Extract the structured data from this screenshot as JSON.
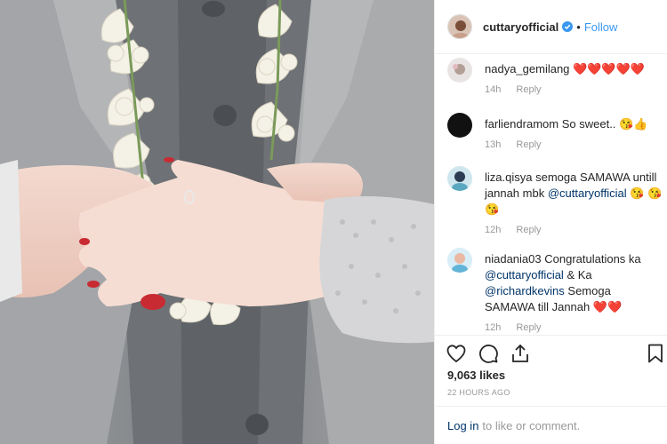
{
  "post": {
    "username": "cuttaryofficial",
    "separator": "•",
    "follow_label": "Follow"
  },
  "comments": [
    {
      "username": "nadya_gemilang",
      "text_segments": [
        "❤️❤️❤️❤️❤️"
      ],
      "time": "14h",
      "reply_label": "Reply"
    },
    {
      "username": "farliendramom",
      "text": "So sweet.. 😘👍",
      "time": "13h",
      "reply_label": "Reply"
    },
    {
      "username": "liza.qisya",
      "text_before": "semoga SAMAWA untill jannah mbk",
      "mention": "@cuttaryofficial",
      "text_after": "😘 😘 😘",
      "time": "12h",
      "reply_label": "Reply"
    },
    {
      "username": "niadania03",
      "text_before": "Congratulations ka",
      "mention1": "@cuttaryofficial",
      "text_mid": "& Ka",
      "mention2": "@richardkevins",
      "text_after": "Semoga SAMAWA till Jannah",
      "hearts": "❤️❤️",
      "time": "12h",
      "reply_label": "Reply"
    }
  ],
  "actions": {
    "like_icon": "heart-outline-icon",
    "comment_icon": "speech-bubble-icon",
    "share_icon": "share-icon",
    "save_icon": "bookmark-icon",
    "likes": "9,063 likes",
    "time_ago": "22 HOURS AGO"
  },
  "login": {
    "link_label": "Log in",
    "rest_label": "to like or comment."
  },
  "colors": {
    "link_blue": "#3897f0",
    "mention_blue": "#003569",
    "heart_red": "#e0102f",
    "muted": "#999999",
    "border": "#efefef"
  }
}
